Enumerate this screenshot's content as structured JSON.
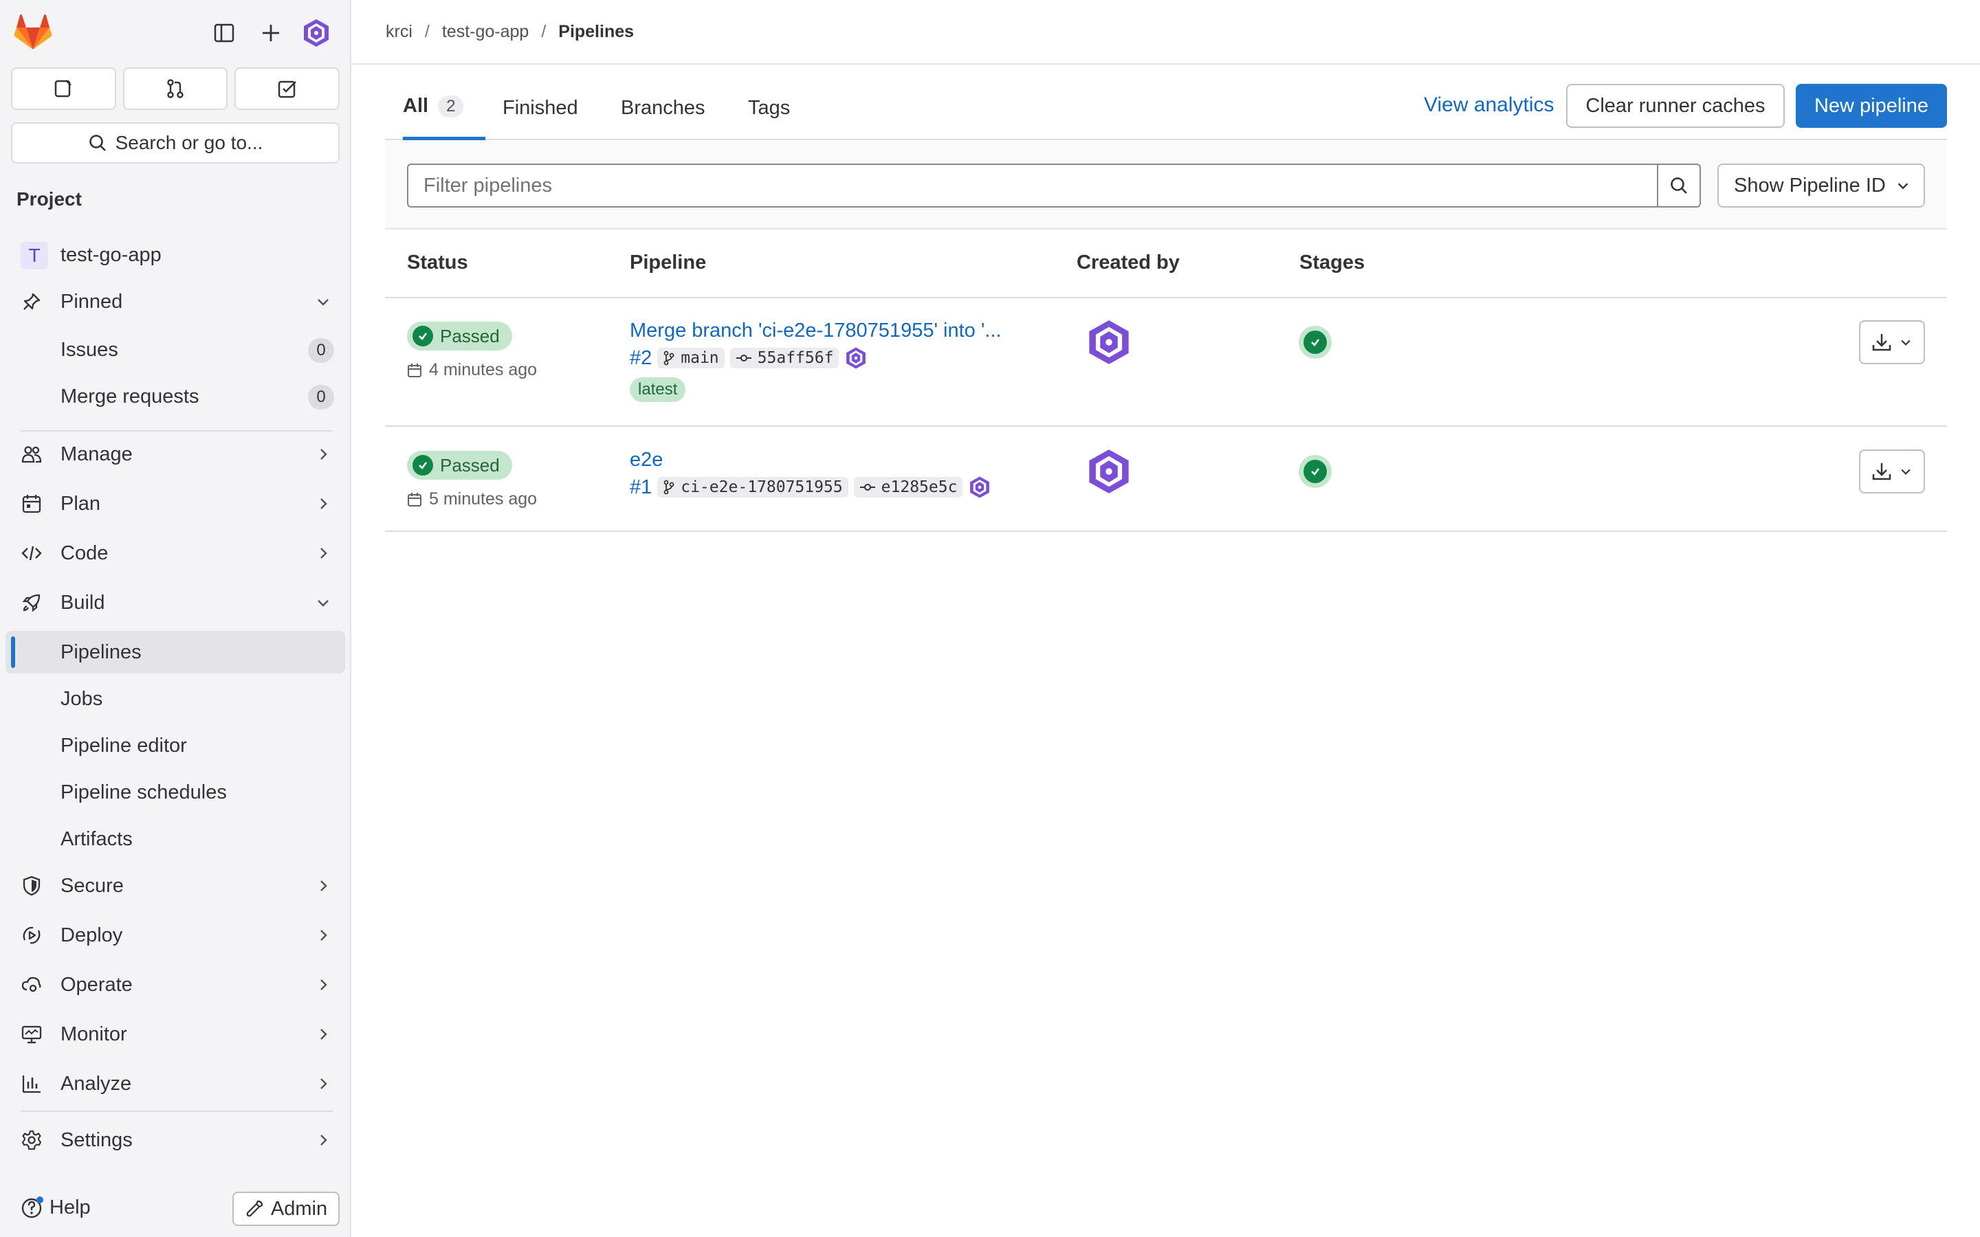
{
  "sidebar": {
    "search_label": "Search or go to...",
    "section_heading": "Project",
    "project": {
      "initial": "T",
      "name": "test-go-app"
    },
    "pinned": {
      "label": "Pinned"
    },
    "pinned_items": [
      {
        "label": "Issues",
        "count": "0"
      },
      {
        "label": "Merge requests",
        "count": "0"
      }
    ],
    "nav": {
      "manage": "Manage",
      "plan": "Plan",
      "code": "Code",
      "build": "Build",
      "secure": "Secure",
      "deploy": "Deploy",
      "operate": "Operate",
      "monitor": "Monitor",
      "analyze": "Analyze",
      "settings": "Settings"
    },
    "build_items": [
      "Pipelines",
      "Jobs",
      "Pipeline editor",
      "Pipeline schedules",
      "Artifacts"
    ],
    "help_label": "Help",
    "admin_label": "Admin"
  },
  "breadcrumb": [
    "krci",
    "test-go-app",
    "Pipelines"
  ],
  "tabs": [
    {
      "label": "All",
      "count": "2"
    },
    {
      "label": "Finished"
    },
    {
      "label": "Branches"
    },
    {
      "label": "Tags"
    }
  ],
  "actions": {
    "analytics": "View analytics",
    "clear_caches": "Clear runner caches",
    "new_pipeline": "New pipeline"
  },
  "filter": {
    "placeholder": "Filter pipelines",
    "pipeline_id_select": "Show Pipeline ID"
  },
  "table": {
    "headers": [
      "Status",
      "Pipeline",
      "Created by",
      "Stages"
    ],
    "rows": [
      {
        "status": "Passed",
        "time": "4 minutes ago",
        "title": "Merge branch 'ci-e2e-1780751955' into '...",
        "id": "#2",
        "ref": "main",
        "commit": "55aff56f",
        "badge": "latest"
      },
      {
        "status": "Passed",
        "time": "5 minutes ago",
        "title": "e2e",
        "id": "#1",
        "ref": "ci-e2e-1780751955",
        "commit": "e1285e5c"
      }
    ]
  },
  "colors": {
    "accent": "#1f75cb",
    "link": "#1068bf",
    "success": "#108548",
    "success_bg": "#c3e6cd",
    "avatar": "#6b4fbb"
  }
}
